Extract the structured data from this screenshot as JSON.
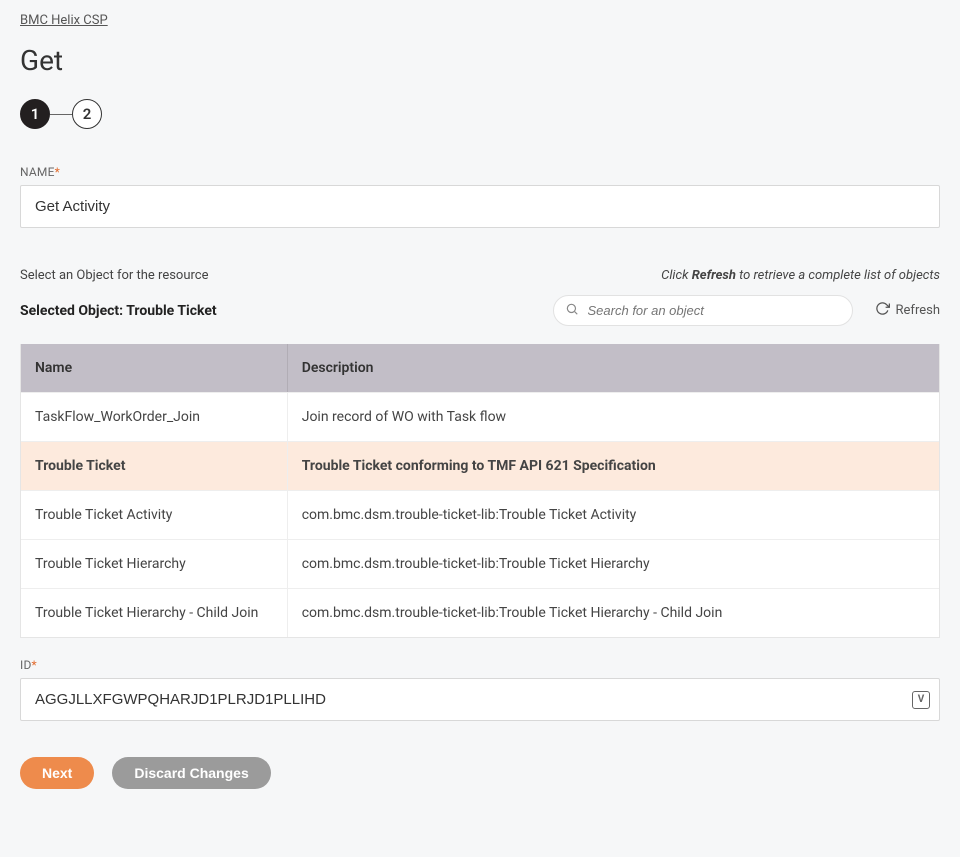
{
  "breadcrumb": "BMC Helix CSP",
  "title": "Get",
  "stepper": {
    "step1": "1",
    "step2": "2"
  },
  "name_field": {
    "label": "NAME",
    "value": "Get Activity"
  },
  "object_section": {
    "prompt": "Select an Object for the resource",
    "hint_prefix": "Click ",
    "hint_bold": "Refresh",
    "hint_suffix": " to retrieve a complete list of objects",
    "selected_label": "Selected Object: Trouble Ticket",
    "search_placeholder": "Search for an object",
    "refresh_label": "Refresh"
  },
  "table": {
    "col_name": "Name",
    "col_desc": "Description",
    "rows": [
      {
        "name": "TaskFlow_WorkOrder_Join",
        "desc": "Join record of WO with Task flow",
        "selected": false
      },
      {
        "name": "Trouble Ticket",
        "desc": "Trouble Ticket conforming to TMF API 621 Specification",
        "selected": true
      },
      {
        "name": "Trouble Ticket Activity",
        "desc": "com.bmc.dsm.trouble-ticket-lib:Trouble Ticket Activity",
        "selected": false
      },
      {
        "name": "Trouble Ticket Hierarchy",
        "desc": "com.bmc.dsm.trouble-ticket-lib:Trouble Ticket Hierarchy",
        "selected": false
      },
      {
        "name": "Trouble Ticket Hierarchy - Child Join",
        "desc": "com.bmc.dsm.trouble-ticket-lib:Trouble Ticket Hierarchy - Child Join",
        "selected": false
      }
    ]
  },
  "id_field": {
    "label": "ID",
    "value": "AGGJLLXFGWPQHARJD1PLRJD1PLLIHD"
  },
  "buttons": {
    "next": "Next",
    "discard": "Discard Changes"
  }
}
